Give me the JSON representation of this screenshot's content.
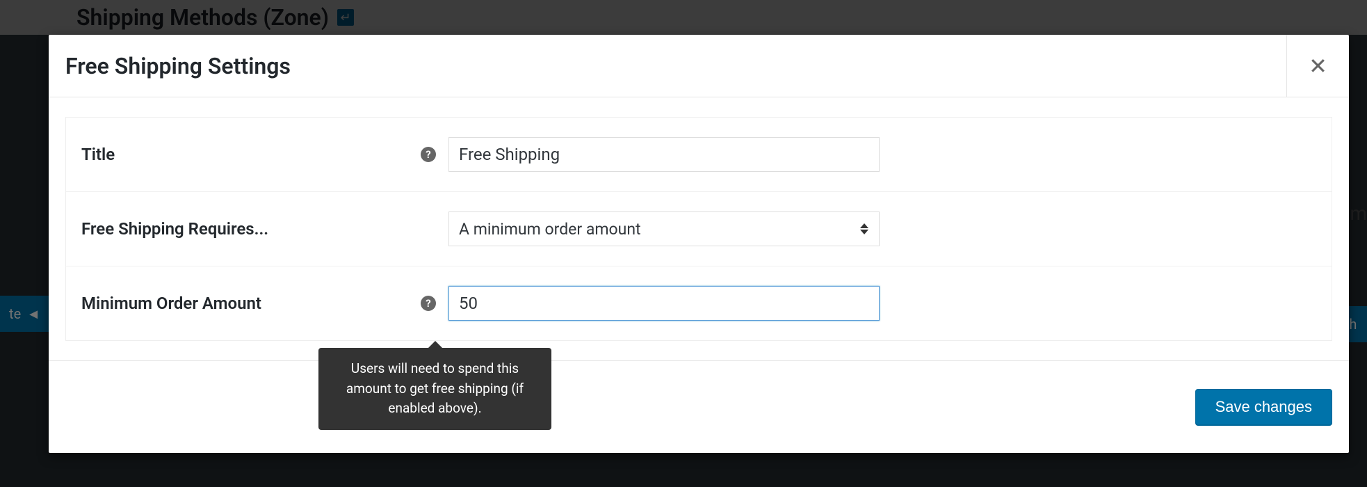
{
  "background": {
    "page_title": "Shipping Methods (Zone)",
    "left_tab_fragment": "te",
    "right_tab_fragment": "sh",
    "right_text_fragment": "m"
  },
  "modal": {
    "title": "Free Shipping Settings",
    "fields": {
      "title": {
        "label": "Title",
        "value": "Free Shipping"
      },
      "requires": {
        "label": "Free Shipping Requires...",
        "selected": "A minimum order amount"
      },
      "min_amount": {
        "label": "Minimum Order Amount",
        "value": "50"
      }
    },
    "tooltip": "Users will need to spend this amount to get free shipping (if enabled above).",
    "save_label": "Save changes"
  }
}
